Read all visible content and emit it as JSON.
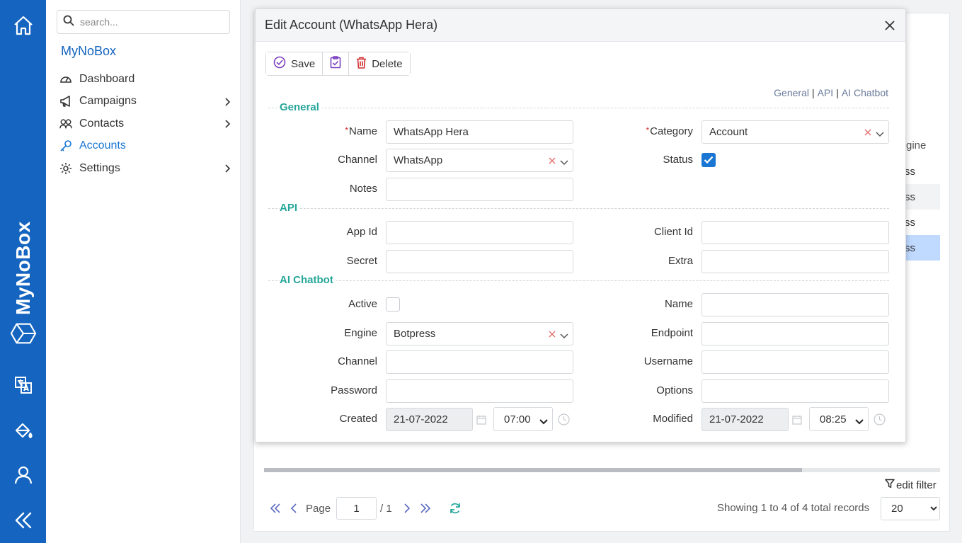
{
  "rail": {
    "brand": "MyNoBox"
  },
  "sidebar": {
    "search_placeholder": "search...",
    "title": "MyNoBox",
    "items": [
      {
        "label": "Dashboard"
      },
      {
        "label": "Campaigns"
      },
      {
        "label": "Contacts"
      },
      {
        "label": "Accounts"
      },
      {
        "label": "Settings"
      }
    ]
  },
  "background": {
    "column_header": "gine",
    "rows": [
      "ss",
      "ss",
      "ss",
      "ss"
    ],
    "edit_filter": "edit filter",
    "pager": {
      "page_label": "Page",
      "page_value": "1",
      "total": "/ 1"
    },
    "showing": "Showing 1 to 4 of 4 total records",
    "page_size": "20"
  },
  "dialog": {
    "title": "Edit Account (WhatsApp Hera)",
    "toolbar": {
      "save": "Save",
      "delete": "Delete"
    },
    "anchors": [
      "General",
      "API",
      "AI Chatbot"
    ],
    "sections": {
      "general": "General",
      "api": "API",
      "ai": "AI Chatbot"
    },
    "labels": {
      "name": "Name",
      "category": "Category",
      "channel": "Channel",
      "status": "Status",
      "notes": "Notes",
      "app_id": "App Id",
      "client_id": "Client Id",
      "secret": "Secret",
      "extra": "Extra",
      "active": "Active",
      "ai_name": "Name",
      "engine": "Engine",
      "endpoint": "Endpoint",
      "ai_channel": "Channel",
      "username": "Username",
      "password": "Password",
      "options": "Options",
      "created": "Created",
      "modified": "Modified"
    },
    "values": {
      "name": "WhatsApp Hera",
      "category": "Account",
      "channel": "WhatsApp",
      "status_checked": true,
      "notes": "",
      "app_id": "",
      "client_id": "",
      "secret": "",
      "extra": "",
      "active_checked": false,
      "ai_name": "",
      "engine": "Botpress",
      "endpoint": "",
      "ai_channel": "",
      "username": "",
      "password": "",
      "options": "",
      "created_date": "21-07-2022",
      "created_time": "07:00",
      "modified_date": "21-07-2022",
      "modified_time": "08:25"
    }
  },
  "colors": {
    "rail": "#1565c0",
    "accent": "#1976d2",
    "section": "#26a69a",
    "danger": "#d32f2f",
    "toolbar_icon": "#7b3fbf"
  }
}
